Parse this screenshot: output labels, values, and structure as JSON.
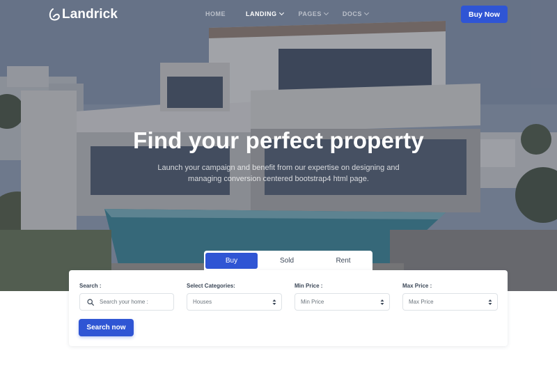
{
  "brand": {
    "name": "Landrick",
    "accent": "#2f55d4"
  },
  "nav": {
    "items": [
      {
        "label": "HOME",
        "active": false,
        "dropdown": false
      },
      {
        "label": "LANDING",
        "active": true,
        "dropdown": true
      },
      {
        "label": "PAGES",
        "active": false,
        "dropdown": true
      },
      {
        "label": "DOCS",
        "active": false,
        "dropdown": true
      }
    ],
    "cta_label": "Buy Now"
  },
  "hero": {
    "title": "Find your perfect property",
    "subtitle": "Launch your campaign and benefit from our expertise on designing and managing conversion centered bootstrap4 html page."
  },
  "tabs": [
    {
      "label": "Buy",
      "active": true
    },
    {
      "label": "Sold",
      "active": false
    },
    {
      "label": "Rent",
      "active": false
    }
  ],
  "search_form": {
    "search": {
      "label": "Search :",
      "placeholder": "Search your home :"
    },
    "category": {
      "label": "Select Categories:",
      "value": "Houses"
    },
    "min_price": {
      "label": "Min Price :",
      "value": "Min Price"
    },
    "max_price": {
      "label": "Max Price :",
      "value": "Max Price"
    },
    "submit_label": "Search now"
  },
  "icons": [
    "logo-icon",
    "chevron-down-icon",
    "search-icon",
    "select-arrows-icon"
  ]
}
